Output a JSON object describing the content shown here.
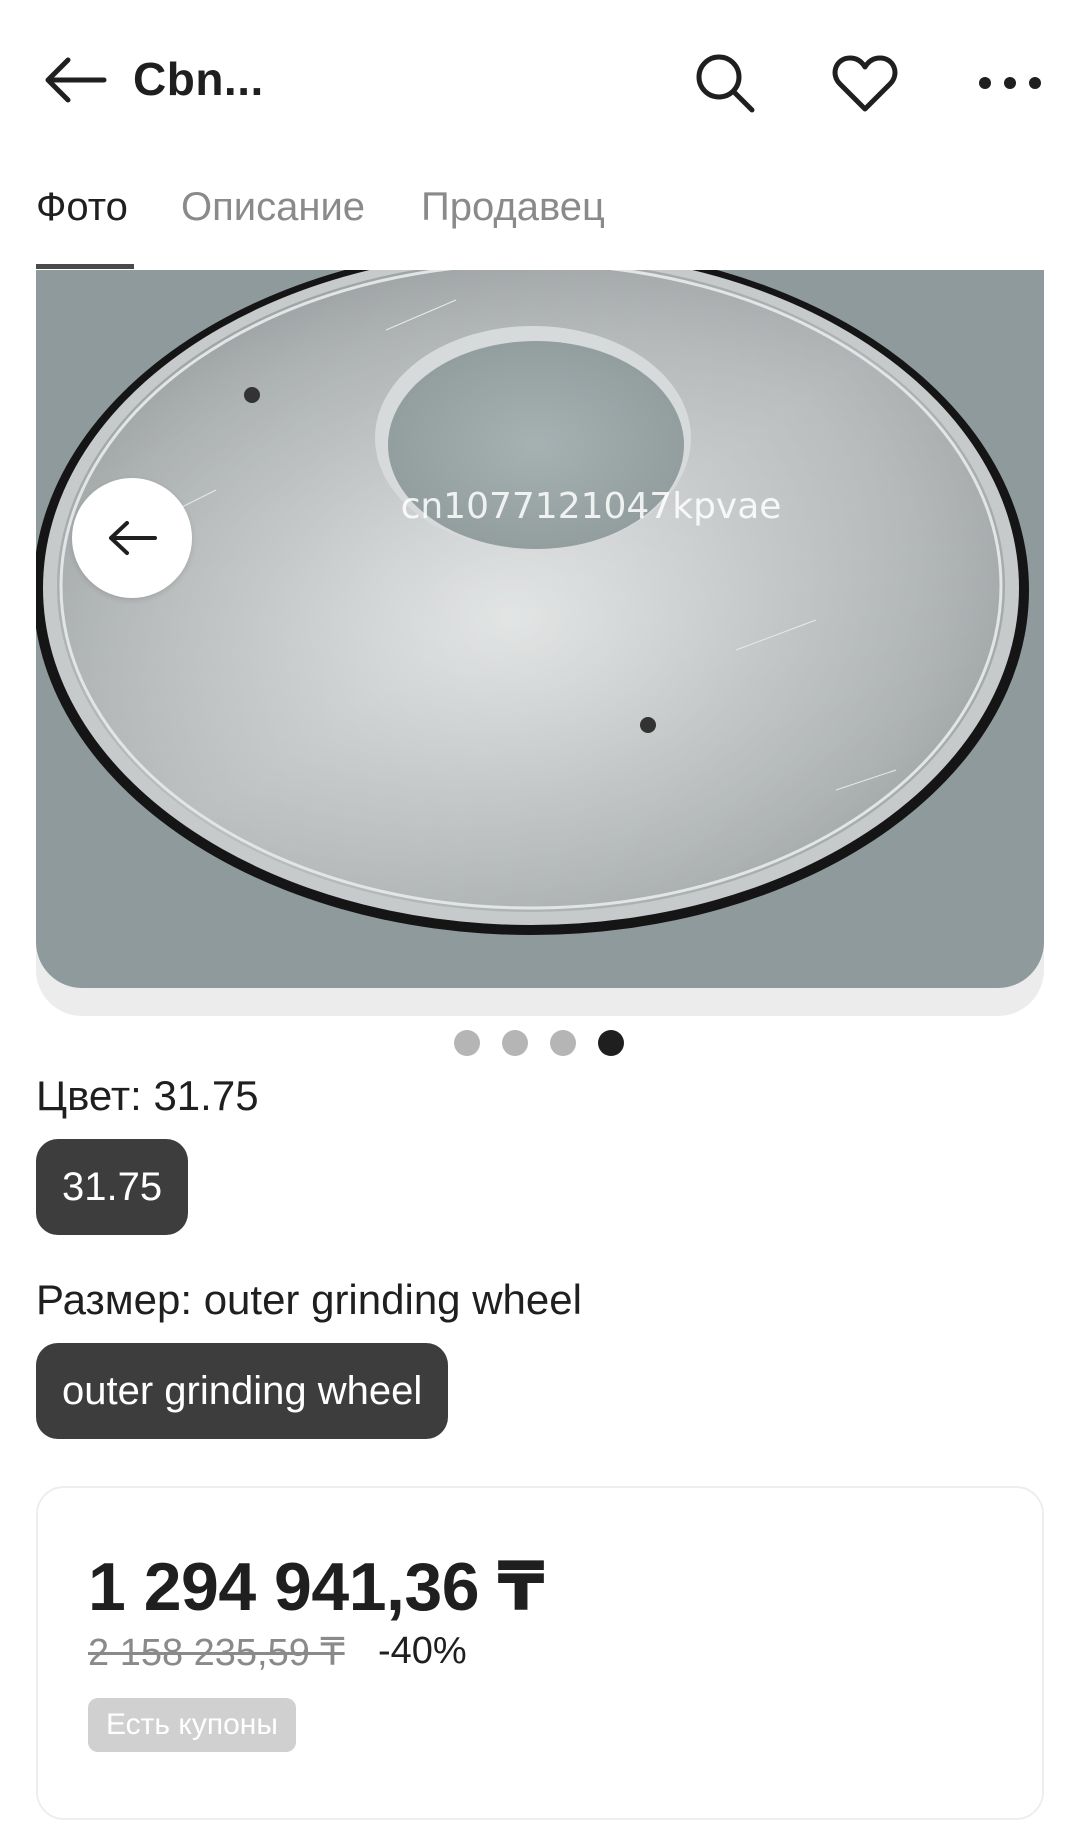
{
  "header": {
    "title": "Cbn...",
    "back_icon": "arrow-left-icon",
    "search_icon": "search-icon",
    "favorite_icon": "heart-icon",
    "more_icon": "more-dots-icon"
  },
  "tabs": [
    {
      "label": "Фото",
      "active": true
    },
    {
      "label": "Описание",
      "active": false
    },
    {
      "label": "Продавец",
      "active": false
    }
  ],
  "gallery": {
    "watermark": "cn1077121047kpvae",
    "slide_count": 4,
    "active_slide": 4,
    "prev_icon": "arrow-left-icon"
  },
  "options": {
    "color_label": "Цвет: 31.75",
    "color_value": "31.75",
    "size_label": "Размер: outer grinding wheel",
    "size_value": "outer grinding wheel"
  },
  "price": {
    "current": "1 294 941,36 ₸",
    "old": "2 158 235,59 ₸",
    "discount": "-40%",
    "coupon_badge": "Есть купоны"
  },
  "colors": {
    "chip_bg": "#3d3d3d",
    "active_dot": "#1f1f1f",
    "inactive_dot": "#b5b5b5"
  }
}
